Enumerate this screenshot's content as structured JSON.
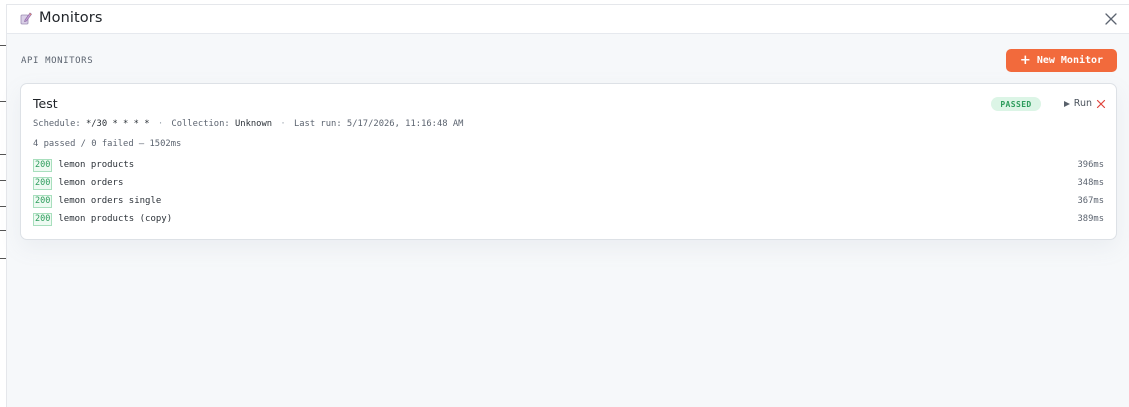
{
  "header": {
    "title": "Monitors",
    "icon": "monitor-pen-icon"
  },
  "section": {
    "label": "API MONITORS",
    "new_button_plus": "+",
    "new_button_label": "New Monitor"
  },
  "colors": {
    "accent": "#f26a3c",
    "passed": "#2d9c5c",
    "passed_bg": "#dcf5e6",
    "danger": "#e0443b"
  },
  "monitor": {
    "title": "Test",
    "status": "PASSED",
    "run_label": "Run",
    "schedule_label": "Schedule:",
    "schedule_value": "*/30 * * * *",
    "collection_label": "Collection:",
    "collection_value": "Unknown",
    "last_run_label": "Last run:",
    "last_run_value": "5/17/2026, 11:16:48 AM",
    "separator": "·",
    "summary": "4 passed / 0 failed — 1502ms",
    "results": [
      {
        "code": "200",
        "name": "lemon products",
        "time": "396ms"
      },
      {
        "code": "200",
        "name": "lemon orders",
        "time": "348ms"
      },
      {
        "code": "200",
        "name": "lemon orders single",
        "time": "367ms"
      },
      {
        "code": "200",
        "name": "lemon products (copy)",
        "time": "389ms"
      }
    ]
  }
}
